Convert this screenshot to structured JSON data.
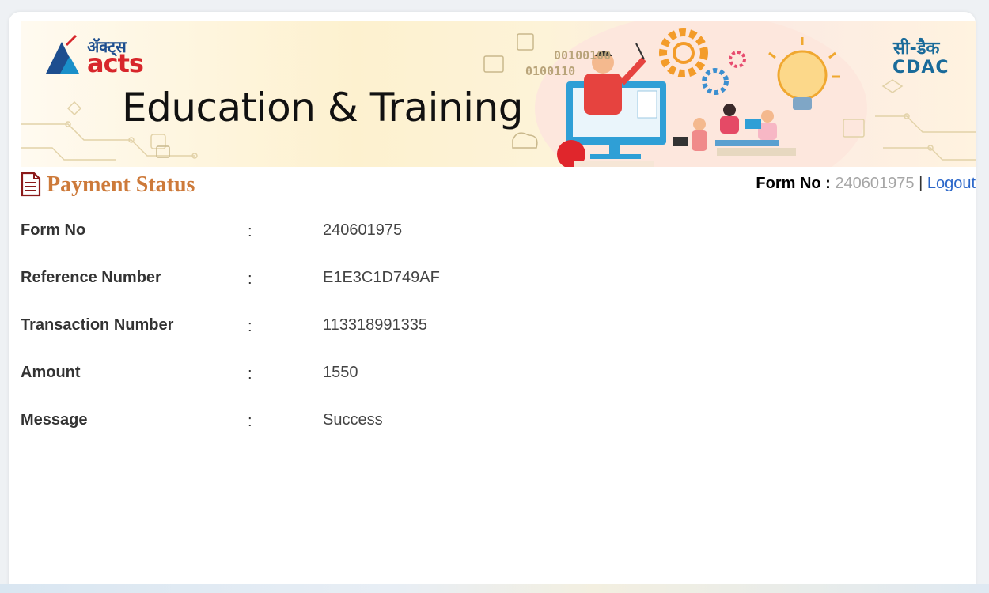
{
  "banner": {
    "logo_hindi": "ॲक्ट्स",
    "logo_name": "acts",
    "title": "Education & Training",
    "cdac_hindi": "सी-डैक",
    "cdac_name": "CDAC",
    "binary_line1": "00100100",
    "binary_line2": "0100110"
  },
  "header": {
    "page_title": "Payment Status",
    "form_no_label": "Form No :",
    "form_no_value": "240601975",
    "separator": "|",
    "logout_label": "Logout"
  },
  "details": [
    {
      "label": "Form No",
      "colon": ":",
      "value": "240601975"
    },
    {
      "label": "Reference Number",
      "colon": ":",
      "value": "E1E3C1D749AF"
    },
    {
      "label": "Transaction Number",
      "colon": ":",
      "value": "113318991335"
    },
    {
      "label": "Amount",
      "colon": ":",
      "value": "1550"
    },
    {
      "label": "Message",
      "colon": ":",
      "value": "Success"
    }
  ],
  "icons": [
    "document-icon",
    "acts-logo-icon",
    "cdac-logo-icon",
    "teacher-illustration-icon",
    "gear-icon",
    "lightbulb-icon"
  ],
  "colors": {
    "title": "#cd7a3a",
    "logout": "#2a66c9",
    "acts_red": "#d7262b",
    "cdac_blue": "#1a6b9a"
  }
}
